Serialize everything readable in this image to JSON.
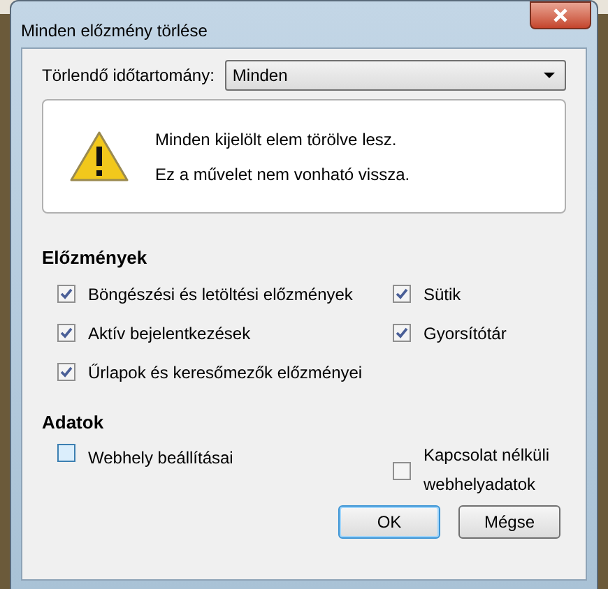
{
  "window": {
    "title": "Minden előzmény törlése"
  },
  "time_range": {
    "label": "Törlendő időtartomány:",
    "value": "Minden"
  },
  "warning": {
    "lines": [
      "Minden kijelölt elem törölve lesz.",
      "Ez a művelet nem vonható vissza."
    ]
  },
  "history": {
    "heading": "Előzmények",
    "columns": [
      {
        "items": [
          {
            "label": "Böngészési és letöltési előzmények",
            "checked": true
          },
          {
            "label": "Aktív bejelentkezések",
            "checked": true
          },
          {
            "label": "Űrlapok és keresőmezők előzményei",
            "checked": true
          }
        ]
      },
      {
        "items": [
          {
            "label": "Sütik",
            "checked": true
          },
          {
            "label": "Gyorsítótár",
            "checked": true
          }
        ]
      }
    ]
  },
  "data": {
    "heading": "Adatok",
    "items": [
      {
        "label": "Webhely beállításai",
        "checked": false,
        "focused": true
      },
      {
        "label": "Kapcsolat nélküli webhelyadatok",
        "checked": false,
        "focused": false
      }
    ]
  },
  "buttons": [
    {
      "label": "OK",
      "default": true
    },
    {
      "label": "Mégse",
      "default": false
    }
  ]
}
